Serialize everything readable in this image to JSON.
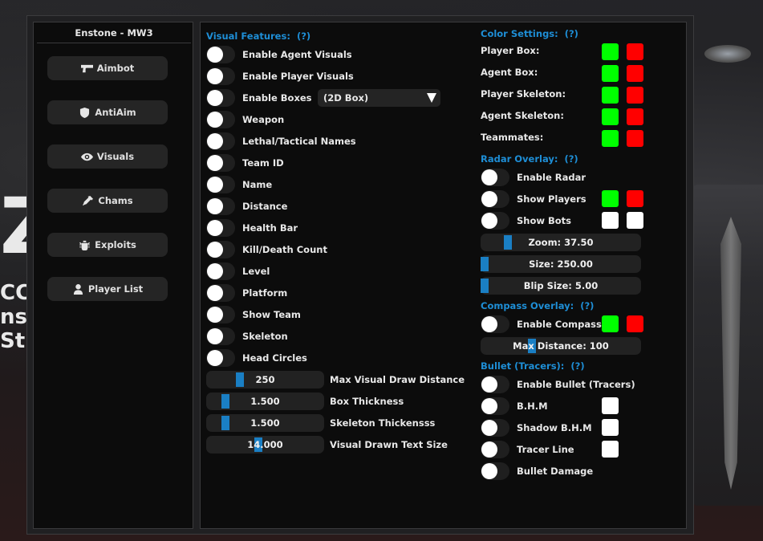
{
  "background": {
    "left_text_lines": [
      "Z",
      "CC",
      "ns (",
      "St"
    ]
  },
  "sidebar": {
    "title": "Enstone - MW3",
    "items": [
      {
        "label": "Aimbot",
        "icon": "gun-icon"
      },
      {
        "label": "AntiAim",
        "icon": "shield-icon"
      },
      {
        "label": "Visuals",
        "icon": "eye-icon"
      },
      {
        "label": "Chams",
        "icon": "dropper-icon"
      },
      {
        "label": "Exploits",
        "icon": "bug-icon"
      },
      {
        "label": "Player List",
        "icon": "user-icon"
      }
    ]
  },
  "visual_features": {
    "title": "Visual Features:",
    "help": "(?)",
    "toggles": [
      "Enable Agent Visuals",
      "Enable Player Visuals",
      "Enable Boxes",
      "Weapon",
      "Lethal/Tactical Names",
      "Team ID",
      "Name",
      "Distance",
      "Health Bar",
      "Kill/Death Count",
      "Level",
      "Platform",
      "Show Team",
      "Skeleton",
      "Head Circles"
    ],
    "box_type_selected": "(2D Box)",
    "sliders": [
      {
        "value": "250",
        "label": "Max Visual Draw Distance",
        "fraction": 0.27
      },
      {
        "value": "1.500",
        "label": "Box Thickness",
        "fraction": 0.14
      },
      {
        "value": "1.500",
        "label": "Skeleton Thickensss",
        "fraction": 0.14
      },
      {
        "value": "14.000",
        "label": "Visual Drawn Text Size",
        "fraction": 0.44
      }
    ]
  },
  "color_settings": {
    "title": "Color Settings:",
    "help": "(?)",
    "rows": [
      {
        "label": "Player Box:",
        "colors": [
          "#00ff00",
          "#ff0000"
        ]
      },
      {
        "label": "Agent Box:",
        "colors": [
          "#00ff00",
          "#ff0000"
        ]
      },
      {
        "label": "Player Skeleton:",
        "colors": [
          "#00ff00",
          "#ff0000"
        ]
      },
      {
        "label": "Agent Skeleton:",
        "colors": [
          "#00ff00",
          "#ff0000"
        ]
      },
      {
        "label": "Teammates:",
        "colors": [
          "#00ff00",
          "#ff0000"
        ]
      }
    ]
  },
  "radar_overlay": {
    "title": "Radar Overlay:",
    "help": "(?)",
    "toggles": [
      {
        "label": "Enable Radar",
        "colors": []
      },
      {
        "label": "Show Players",
        "colors": [
          "#00ff00",
          "#ff0000"
        ]
      },
      {
        "label": "Show Bots",
        "colors": [
          "#ffffff",
          "#ffffff"
        ]
      }
    ],
    "sliders": [
      {
        "text": "Zoom: 37.50",
        "fraction": 0.15
      },
      {
        "text": "Size: 250.00",
        "fraction": 0.0
      },
      {
        "text": "Blip Size: 5.00",
        "fraction": 0.0
      }
    ]
  },
  "compass_overlay": {
    "title": "Compass Overlay:",
    "help": "(?)",
    "toggle": {
      "label": "Enable Compass",
      "colors": [
        "#00ff00",
        "#ff0000"
      ]
    },
    "slider": {
      "text": "Max Distance: 100",
      "fraction": 0.31
    }
  },
  "bullet_tracers": {
    "title": "Bullet (Tracers):",
    "help": "(?)",
    "toggles": [
      {
        "label": "Enable Bullet (Tracers)",
        "color": null
      },
      {
        "label": "B.H.M",
        "color": "#ffffff"
      },
      {
        "label": "Shadow B.H.M",
        "color": "#ffffff"
      },
      {
        "label": "Tracer Line",
        "color": "#ffffff"
      },
      {
        "label": "Bullet Damage",
        "color": null
      }
    ]
  },
  "colors": {
    "accent": "#1e8ed6",
    "slider_handle": "#1a7fc4",
    "panel_bg": "#0c0c0c"
  }
}
